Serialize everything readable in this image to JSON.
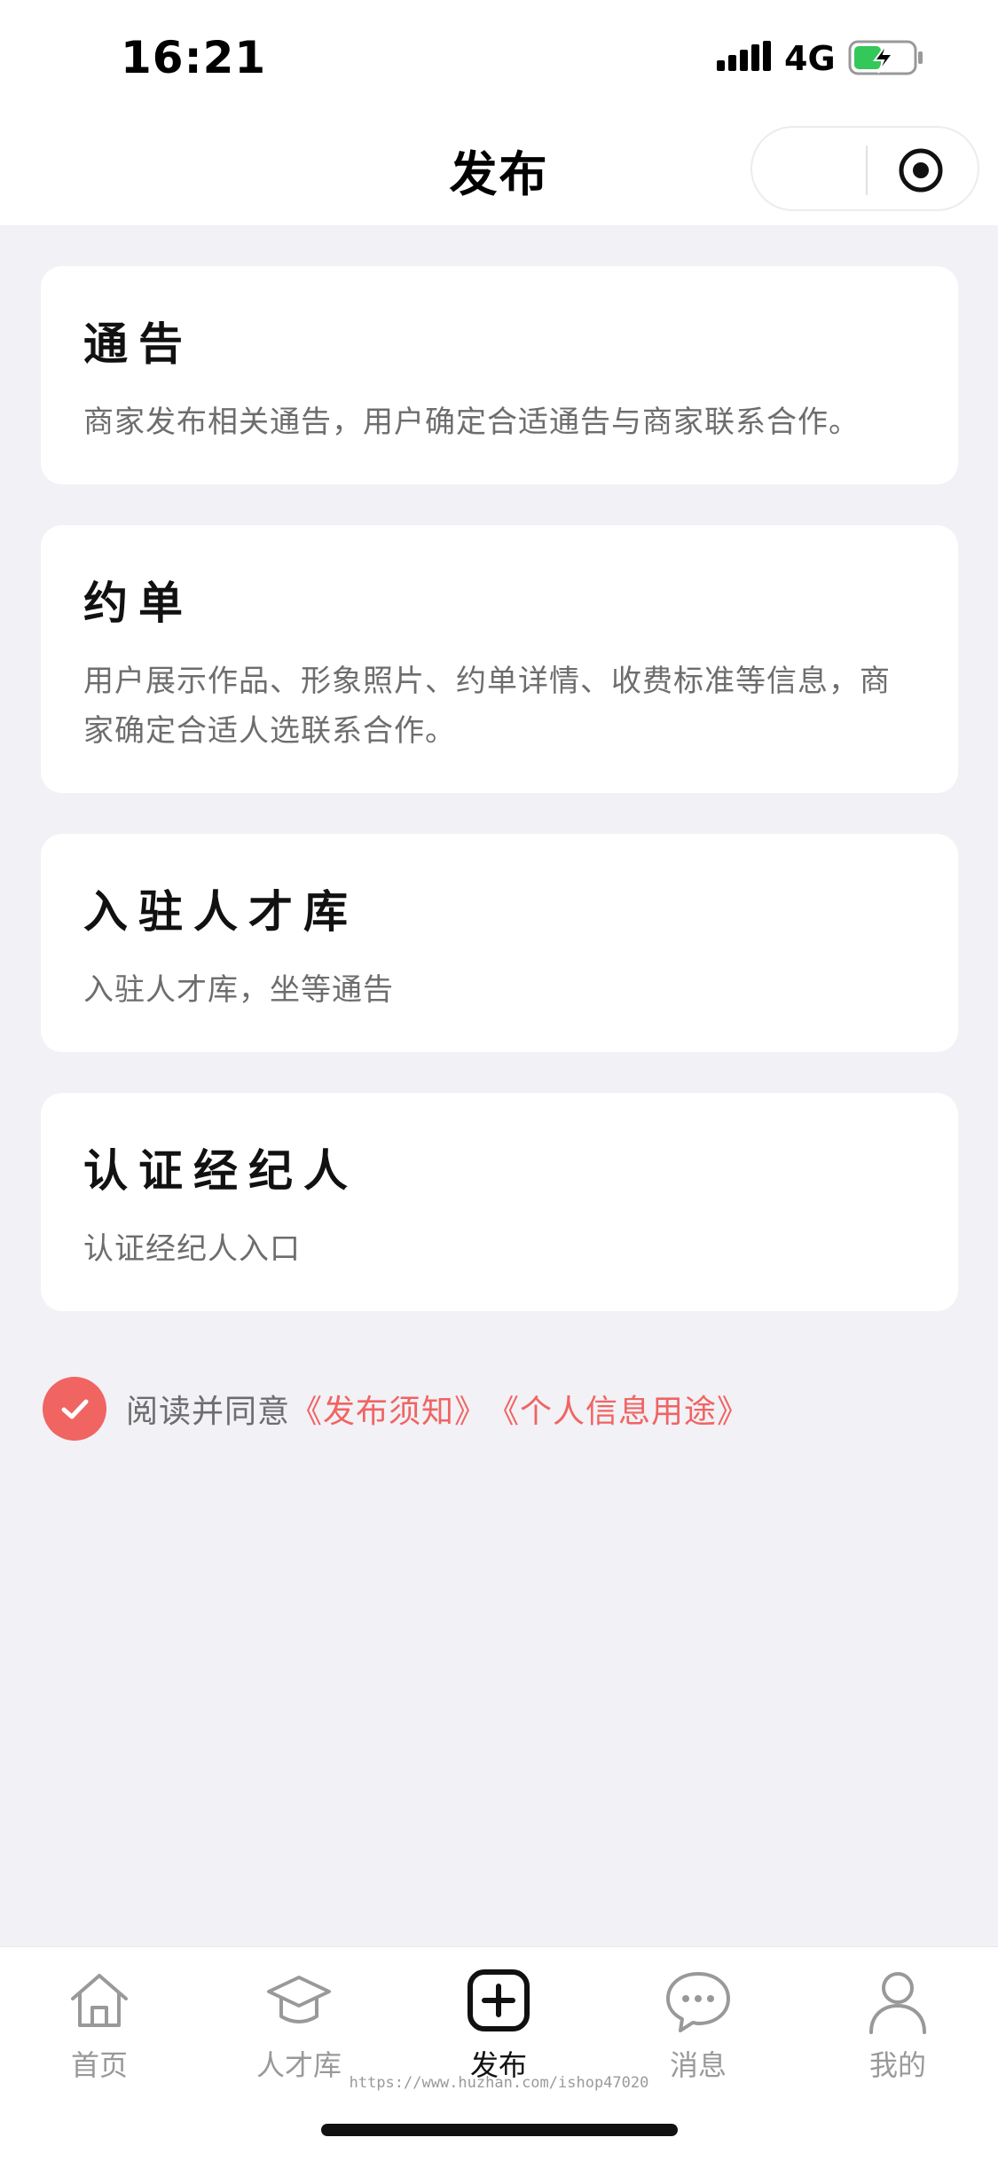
{
  "status_bar": {
    "time": "16:21",
    "network": "4G",
    "icons": [
      "signal-icon",
      "battery-charging-icon"
    ]
  },
  "nav": {
    "title": "发布",
    "capsule_icons": [
      "more-icon",
      "target-icon"
    ]
  },
  "cards": [
    {
      "title": "通告",
      "desc": "商家发布相关通告，用户确定合适通告与商家联系合作。"
    },
    {
      "title": "约单",
      "desc": "用户展示作品、形象照片、约单详情、收费标准等信息，商家确定合适人选联系合作。"
    },
    {
      "title": "入驻人才库",
      "desc": "入驻人才库，坐等通告"
    },
    {
      "title": "认证经纪人",
      "desc": "认证经纪人入口"
    }
  ],
  "agreement": {
    "checked": true,
    "prefix": "阅读并同意",
    "link_1": "《发布须知》",
    "link_2": "《个人信息用途》"
  },
  "tab_bar": {
    "items": [
      {
        "label": "首页",
        "icon": "home-icon"
      },
      {
        "label": "人才库",
        "icon": "graduation-cap-icon"
      },
      {
        "label": "发布",
        "icon": "add-square-icon"
      },
      {
        "label": "消息",
        "icon": "chat-bubble-icon"
      },
      {
        "label": "我的",
        "icon": "user-icon"
      }
    ],
    "active_index": 2
  },
  "watermark": "https://www.huzhan.com/ishop47020",
  "colors": {
    "accent": "#f06462",
    "background": "#f1f1f6",
    "card": "#ffffff",
    "muted_text": "#6d6d6d"
  }
}
